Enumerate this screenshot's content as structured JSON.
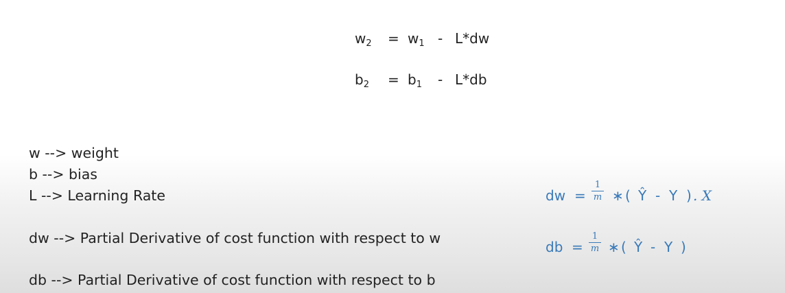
{
  "equations": {
    "w_update": {
      "lhs": "w",
      "lhs_sub": "2",
      "eq": "=",
      "rhs": "w",
      "rhs_sub": "1",
      "op": "-",
      "term": "L*dw"
    },
    "b_update": {
      "lhs": "b",
      "lhs_sub": "2",
      "eq": "=",
      "rhs": "b",
      "rhs_sub": "1",
      "op": "-",
      "term": "L*db"
    }
  },
  "definitions": [
    "w --> weight",
    "b  --> bias",
    "L -->  Learning Rate",
    "dw  --> Partial Derivative of cost function with respect to w",
    "db  --> Partial Derivative of cost function with respect to b"
  ],
  "gradients": {
    "dw": {
      "lhs": "dw",
      "eq": "=",
      "frac_num": "1",
      "frac_den": "m",
      "times": "∗",
      "open": "(",
      "yhat": "Ŷ",
      "minus": "-",
      "y": "Y",
      "close": ")",
      "dot_x": ". X"
    },
    "db": {
      "lhs": "db",
      "eq": "=",
      "frac_num": "1",
      "frac_den": "m",
      "times": "∗",
      "open": "(",
      "yhat": "Ŷ",
      "minus": "-",
      "y": "Y",
      "close": ")"
    }
  },
  "colors": {
    "text": "#222222",
    "formula": "#3a7ab8"
  }
}
